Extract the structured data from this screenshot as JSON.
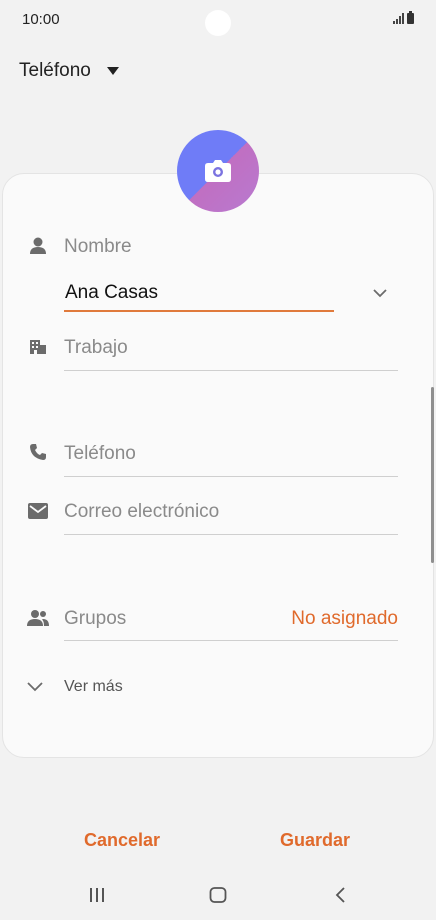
{
  "status_bar": {
    "time": "10:00"
  },
  "account": {
    "label": "Teléfono",
    "icon": "caret-down-icon"
  },
  "form": {
    "name": {
      "label": "Nombre",
      "value": "Ana Casas",
      "icon": "person-icon"
    },
    "work": {
      "label": "Trabajo",
      "icon": "building-icon"
    },
    "phone": {
      "label": "Teléfono",
      "icon": "phone-icon"
    },
    "email": {
      "label": "Correo electrónico",
      "icon": "mail-icon"
    },
    "groups": {
      "label": "Grupos",
      "value": "No asignado",
      "icon": "people-icon"
    },
    "more": {
      "label": "Ver más",
      "icon": "chevron-down-icon"
    }
  },
  "actions": {
    "cancel": "Cancelar",
    "save": "Guardar"
  },
  "colors": {
    "accent": "#e06a2c",
    "avatar_blue": "#6f7cf7",
    "avatar_pink": "#c06fc2"
  }
}
